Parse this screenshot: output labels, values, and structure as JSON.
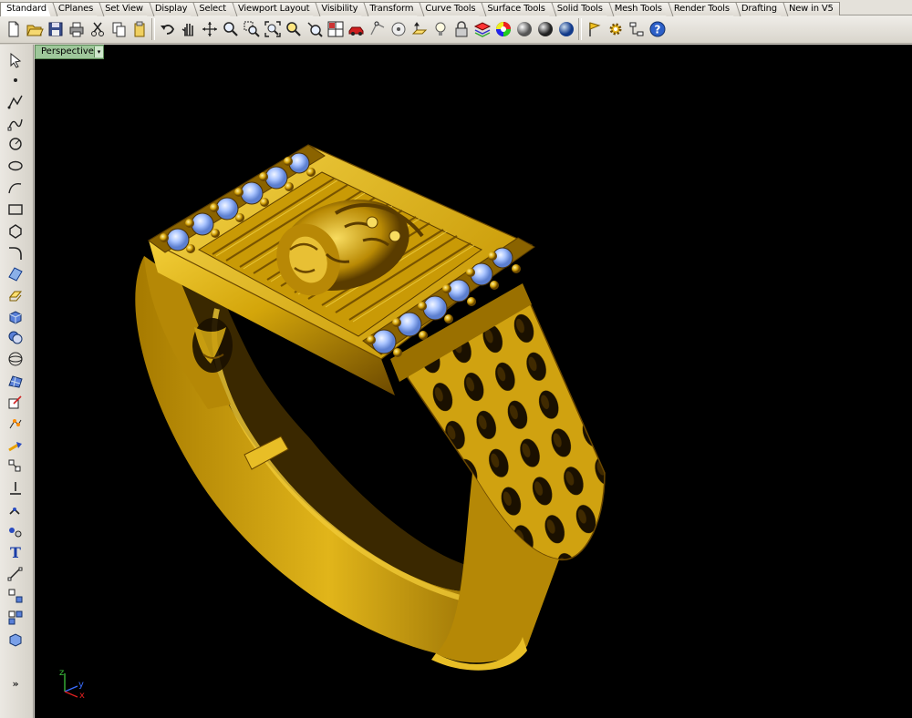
{
  "tabs": [
    {
      "label": "Standard",
      "active": true
    },
    {
      "label": "CPlanes"
    },
    {
      "label": "Set View"
    },
    {
      "label": "Display"
    },
    {
      "label": "Select"
    },
    {
      "label": "Viewport Layout"
    },
    {
      "label": "Visibility"
    },
    {
      "label": "Transform"
    },
    {
      "label": "Curve Tools"
    },
    {
      "label": "Surface Tools"
    },
    {
      "label": "Solid Tools"
    },
    {
      "label": "Mesh Tools"
    },
    {
      "label": "Render Tools"
    },
    {
      "label": "Drafting"
    },
    {
      "label": "New in V5"
    }
  ],
  "toolbar_icons": [
    "new-file-icon",
    "open-folder-icon",
    "save-icon",
    "print-icon",
    "cut-icon",
    "copy-icon",
    "paste-icon",
    "undo-icon",
    "pan-hand-icon",
    "rotate-view-icon",
    "zoom-window-icon",
    "zoom-dynamic-icon",
    "zoom-extents-icon",
    "zoom-selected-icon",
    "zoom-target-icon",
    "four-viewports-icon",
    "car-icon",
    "grid-snap-icon",
    "osnap-icon",
    "cplane-icon",
    "light-bulb-icon",
    "lock-icon",
    "layer-icon",
    "color-wheel-icon",
    "rendered-sphere-icon",
    "shaded-sphere-icon",
    "render-sphere-icon",
    "flag-icon",
    "gear-options-icon",
    "properties-icon",
    "help-icon"
  ],
  "left_tools": [
    "select-arrow-icon",
    "point-icon",
    "polyline-icon",
    "curve-icon",
    "circle-icon",
    "ellipse-icon",
    "arc-icon",
    "rectangle-icon",
    "polygon-icon",
    "fillet-curve-icon",
    "surface-icon",
    "extrude-icon",
    "box-solid-icon",
    "boolean-icon",
    "sphere-icon",
    "mesh-icon",
    "gumball-icon",
    "edit-points-icon",
    "move-icon",
    "array-icon",
    "split-icon",
    "join-icon",
    "trim-icon",
    "text-icon",
    "dimension-icon",
    "transform-icon",
    "blocks-icon",
    "render-icon",
    "more-icon"
  ],
  "viewport": {
    "title": "Perspective",
    "menu_arrow": "▾"
  },
  "axes": {
    "x": "x",
    "y": "y",
    "z": "z"
  },
  "colors": {
    "gold": "#d4a90c",
    "gold_dark": "#6b4a00",
    "gem": "#9fbfff",
    "viewport_bg": "#000000",
    "tab_active": "#ffffff"
  }
}
